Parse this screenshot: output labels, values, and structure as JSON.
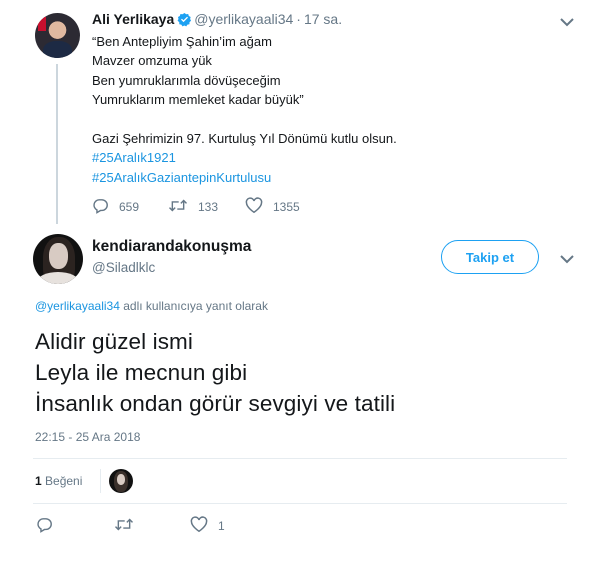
{
  "parent_tweet": {
    "author_name": "Ali Yerlikaya",
    "author_handle": "@yerlikayaali34",
    "time": "17 sa.",
    "lines": [
      "“Ben Antepliyim Şahin’im ağam",
      "Mavzer omzuma yük",
      "Ben yumruklarımla dövüşeceğim",
      "Yumruklarım memleket kadar büyük”"
    ],
    "message": "Gazi Şehrimizin 97. Kurtuluş Yıl Dönümü kutlu olsun.",
    "hashtags": [
      "#25Aralık1921",
      "#25AralıkGaziantepinKurtulusu"
    ],
    "reply_count": "659",
    "retweet_count": "133",
    "like_count": "1355"
  },
  "main_tweet": {
    "author_name": "kendiarandakonuşma",
    "author_handle": "@Siladlklc",
    "follow_label": "Takip et",
    "reply_mention": "@yerlikayaali34",
    "reply_suffix": " adlı kullanıcıya yanıt olarak",
    "text_lines": [
      "Alidir güzel ismi",
      "Leyla ile mecnun gibi",
      "İnsanlık ondan görür sevgiyi ve tatili"
    ],
    "timestamp": "22:15 - 25 Ara 2018",
    "likes_count": "1",
    "likes_label": "Beğeni",
    "footer_like_count": "1"
  },
  "colors": {
    "accent": "#1da1f2",
    "link": "#1b95e0",
    "secondary_text": "#657786",
    "divider": "#e6ecf0"
  },
  "icons": [
    "verified-badge-icon",
    "reply-icon",
    "retweet-icon",
    "like-icon",
    "chevron-down-icon"
  ]
}
